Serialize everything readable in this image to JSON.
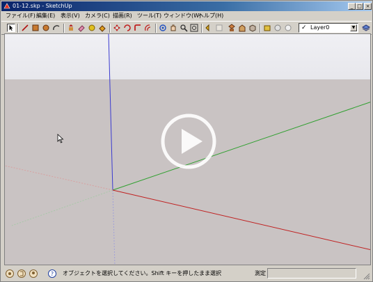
{
  "window": {
    "title": "01-12.skp - SketchUp",
    "min_glyph": "_",
    "max_glyph": "□",
    "close_glyph": "×"
  },
  "menu": [
    {
      "label": "ファイル(F)"
    },
    {
      "label": "編集(E)"
    },
    {
      "label": "表示(V)"
    },
    {
      "label": "カメラ(C)"
    },
    {
      "label": "描画(R)"
    },
    {
      "label": "ツール(T)"
    },
    {
      "label": "ウィンドウ(W)"
    },
    {
      "label": "ヘルプ(H)"
    }
  ],
  "toolbar": {
    "layer_check": "✓",
    "layer_value": "Layer0",
    "dropdown_glyph": "▼"
  },
  "statusbar": {
    "message": "オブジェクトを選択してください。Shift キーを押したまま選択",
    "measure_label": "測定",
    "measure_value": ""
  },
  "colors": {
    "title_active": "#0a246a",
    "axis_blue": "#3a3ad0",
    "axis_green": "#2fa02f",
    "axis_red": "#c02020",
    "sky": "#ececf0",
    "ground": "#c9c3c3"
  },
  "icons": [
    "select-icon",
    "line-icon",
    "rectangle-icon",
    "circle-icon",
    "arc-icon",
    "eraser-icon",
    "paint-icon",
    "push-pull-icon",
    "move-icon",
    "rotate-icon",
    "offset-icon",
    "orbit-icon",
    "pan-icon",
    "zoom-icon",
    "zoom-extents-icon",
    "layers-icon",
    "help-icon",
    "play-icon"
  ]
}
